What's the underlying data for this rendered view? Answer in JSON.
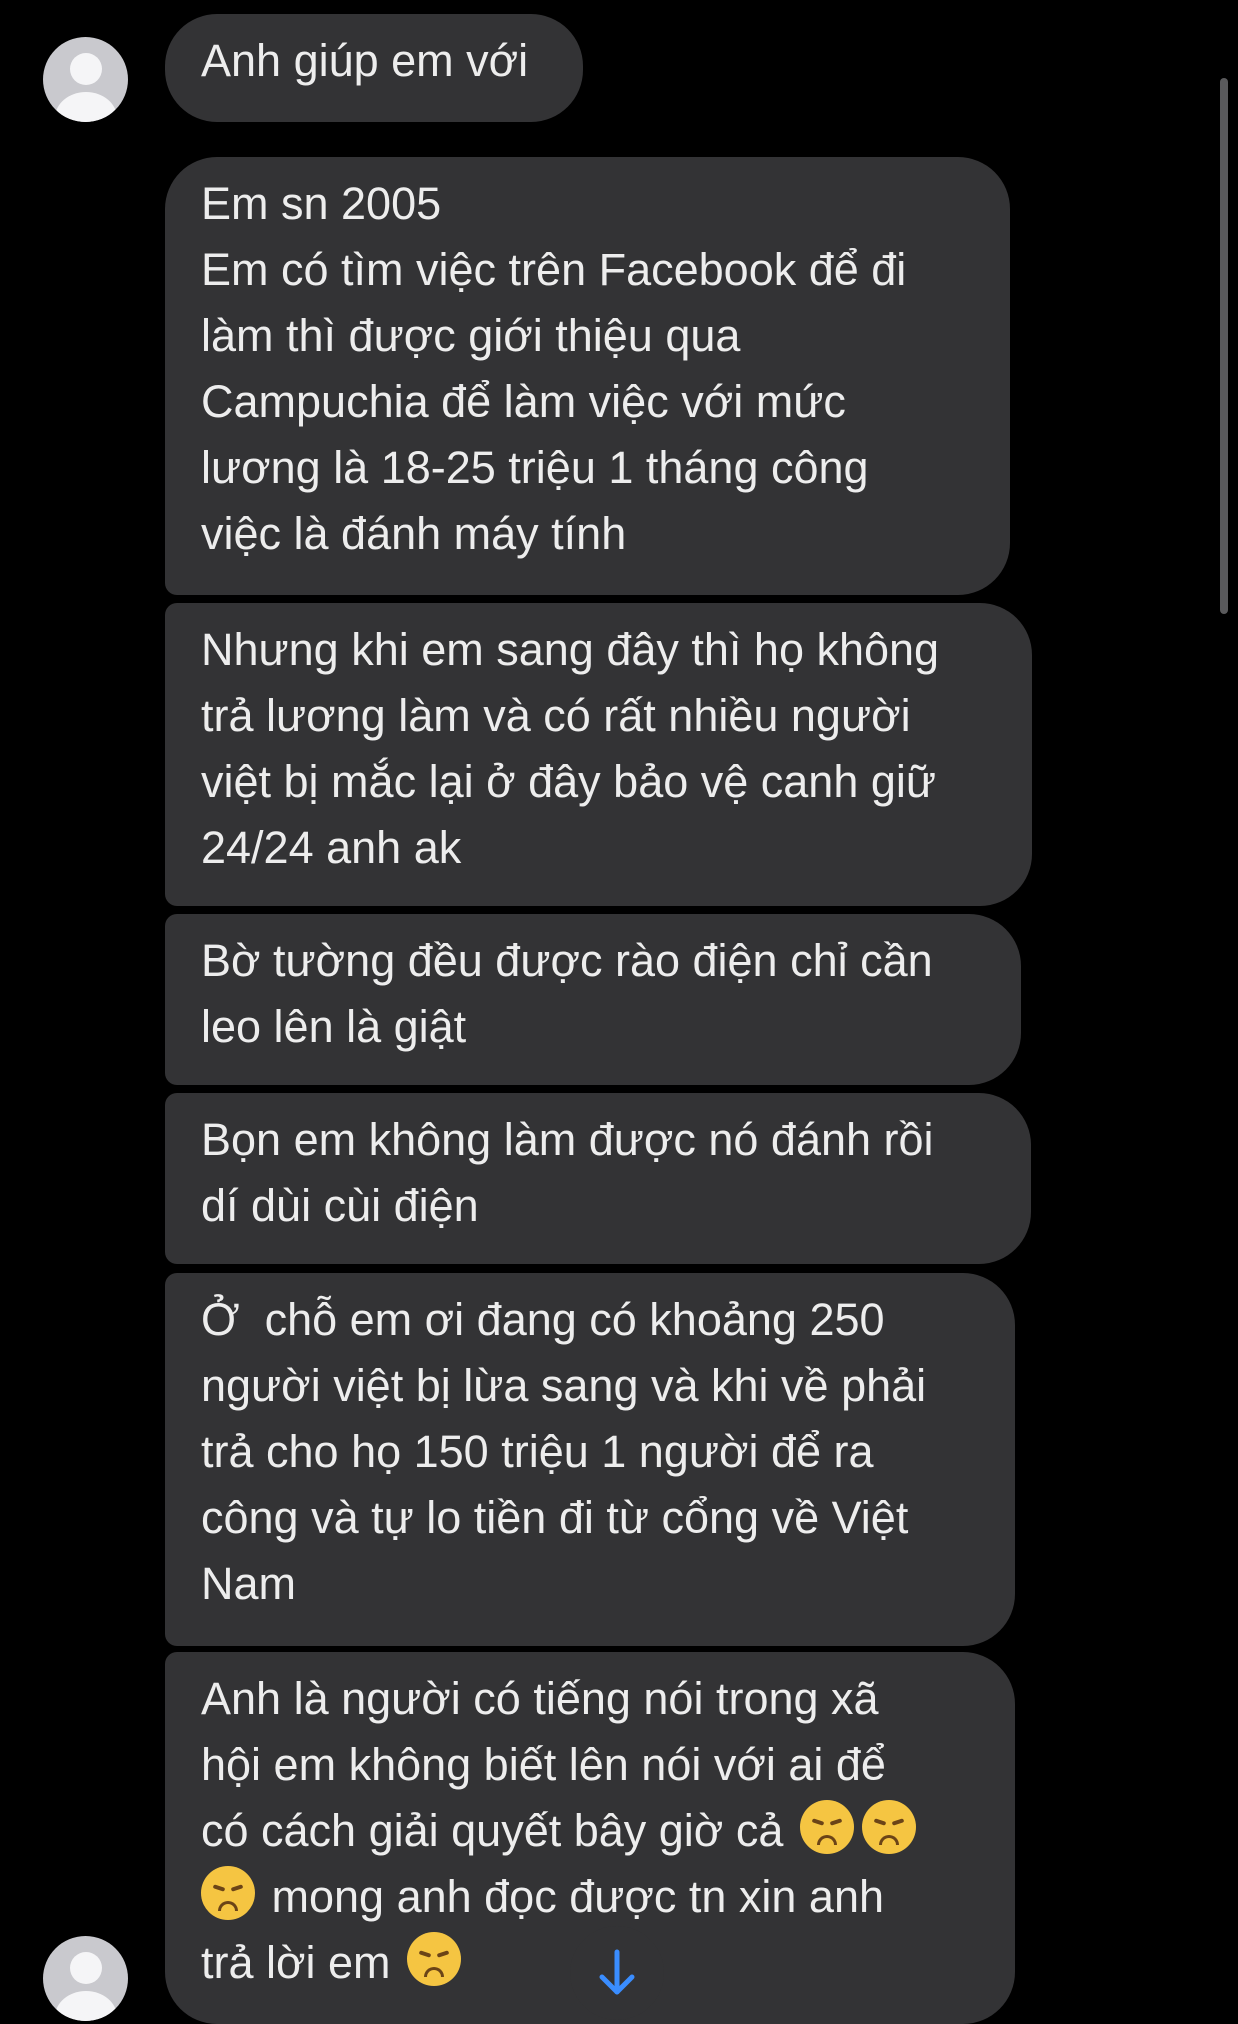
{
  "messages": [
    {
      "text": "Anh giúp em với"
    },
    {
      "text": "Em sn 2005\nEm có tìm việc trên Facebook để đi\nlàm thì được giới thiệu qua\nCampuchia để làm việc với mức\nlương là 18-25 triệu 1 tháng công\nviệc là đánh máy tính"
    },
    {
      "text": "Nhưng khi em sang đây thì họ không\ntrả lương làm và có rất nhiều người\nviệt bị mắc lại ở đây bảo vệ canh giữ\n24/24 anh ak"
    },
    {
      "text": "Bờ tường đều được rào điện chỉ cần\nleo lên là giật"
    },
    {
      "text": "Bọn em không làm được nó đánh rồi\ndí dùi cùi điện"
    },
    {
      "text": "Ở  chỗ em ơi đang có khoảng 250\nngười việt bị lừa sang và khi về phải\ntrả cho họ 150 triệu 1 người để ra\ncông và tự lo tiền đi từ cổng về Việt\nNam"
    },
    {
      "line1": "Anh là người có tiếng nói trong xã",
      "line2": "hội em không biết lên nói với ai để",
      "line3": "có cách giải quyết bây giờ cả ",
      "line4": " mong anh đọc được tn xin anh",
      "line5": "trả lời em "
    }
  ],
  "emoji_name": "disappointed-face",
  "icons": {
    "avatar": "default-user-avatar-icon",
    "scroll": "arrow-down-icon"
  },
  "colors": {
    "background": "#000000",
    "bubble": "#333335",
    "text": "#ededed",
    "accent": "#3a8dff"
  }
}
